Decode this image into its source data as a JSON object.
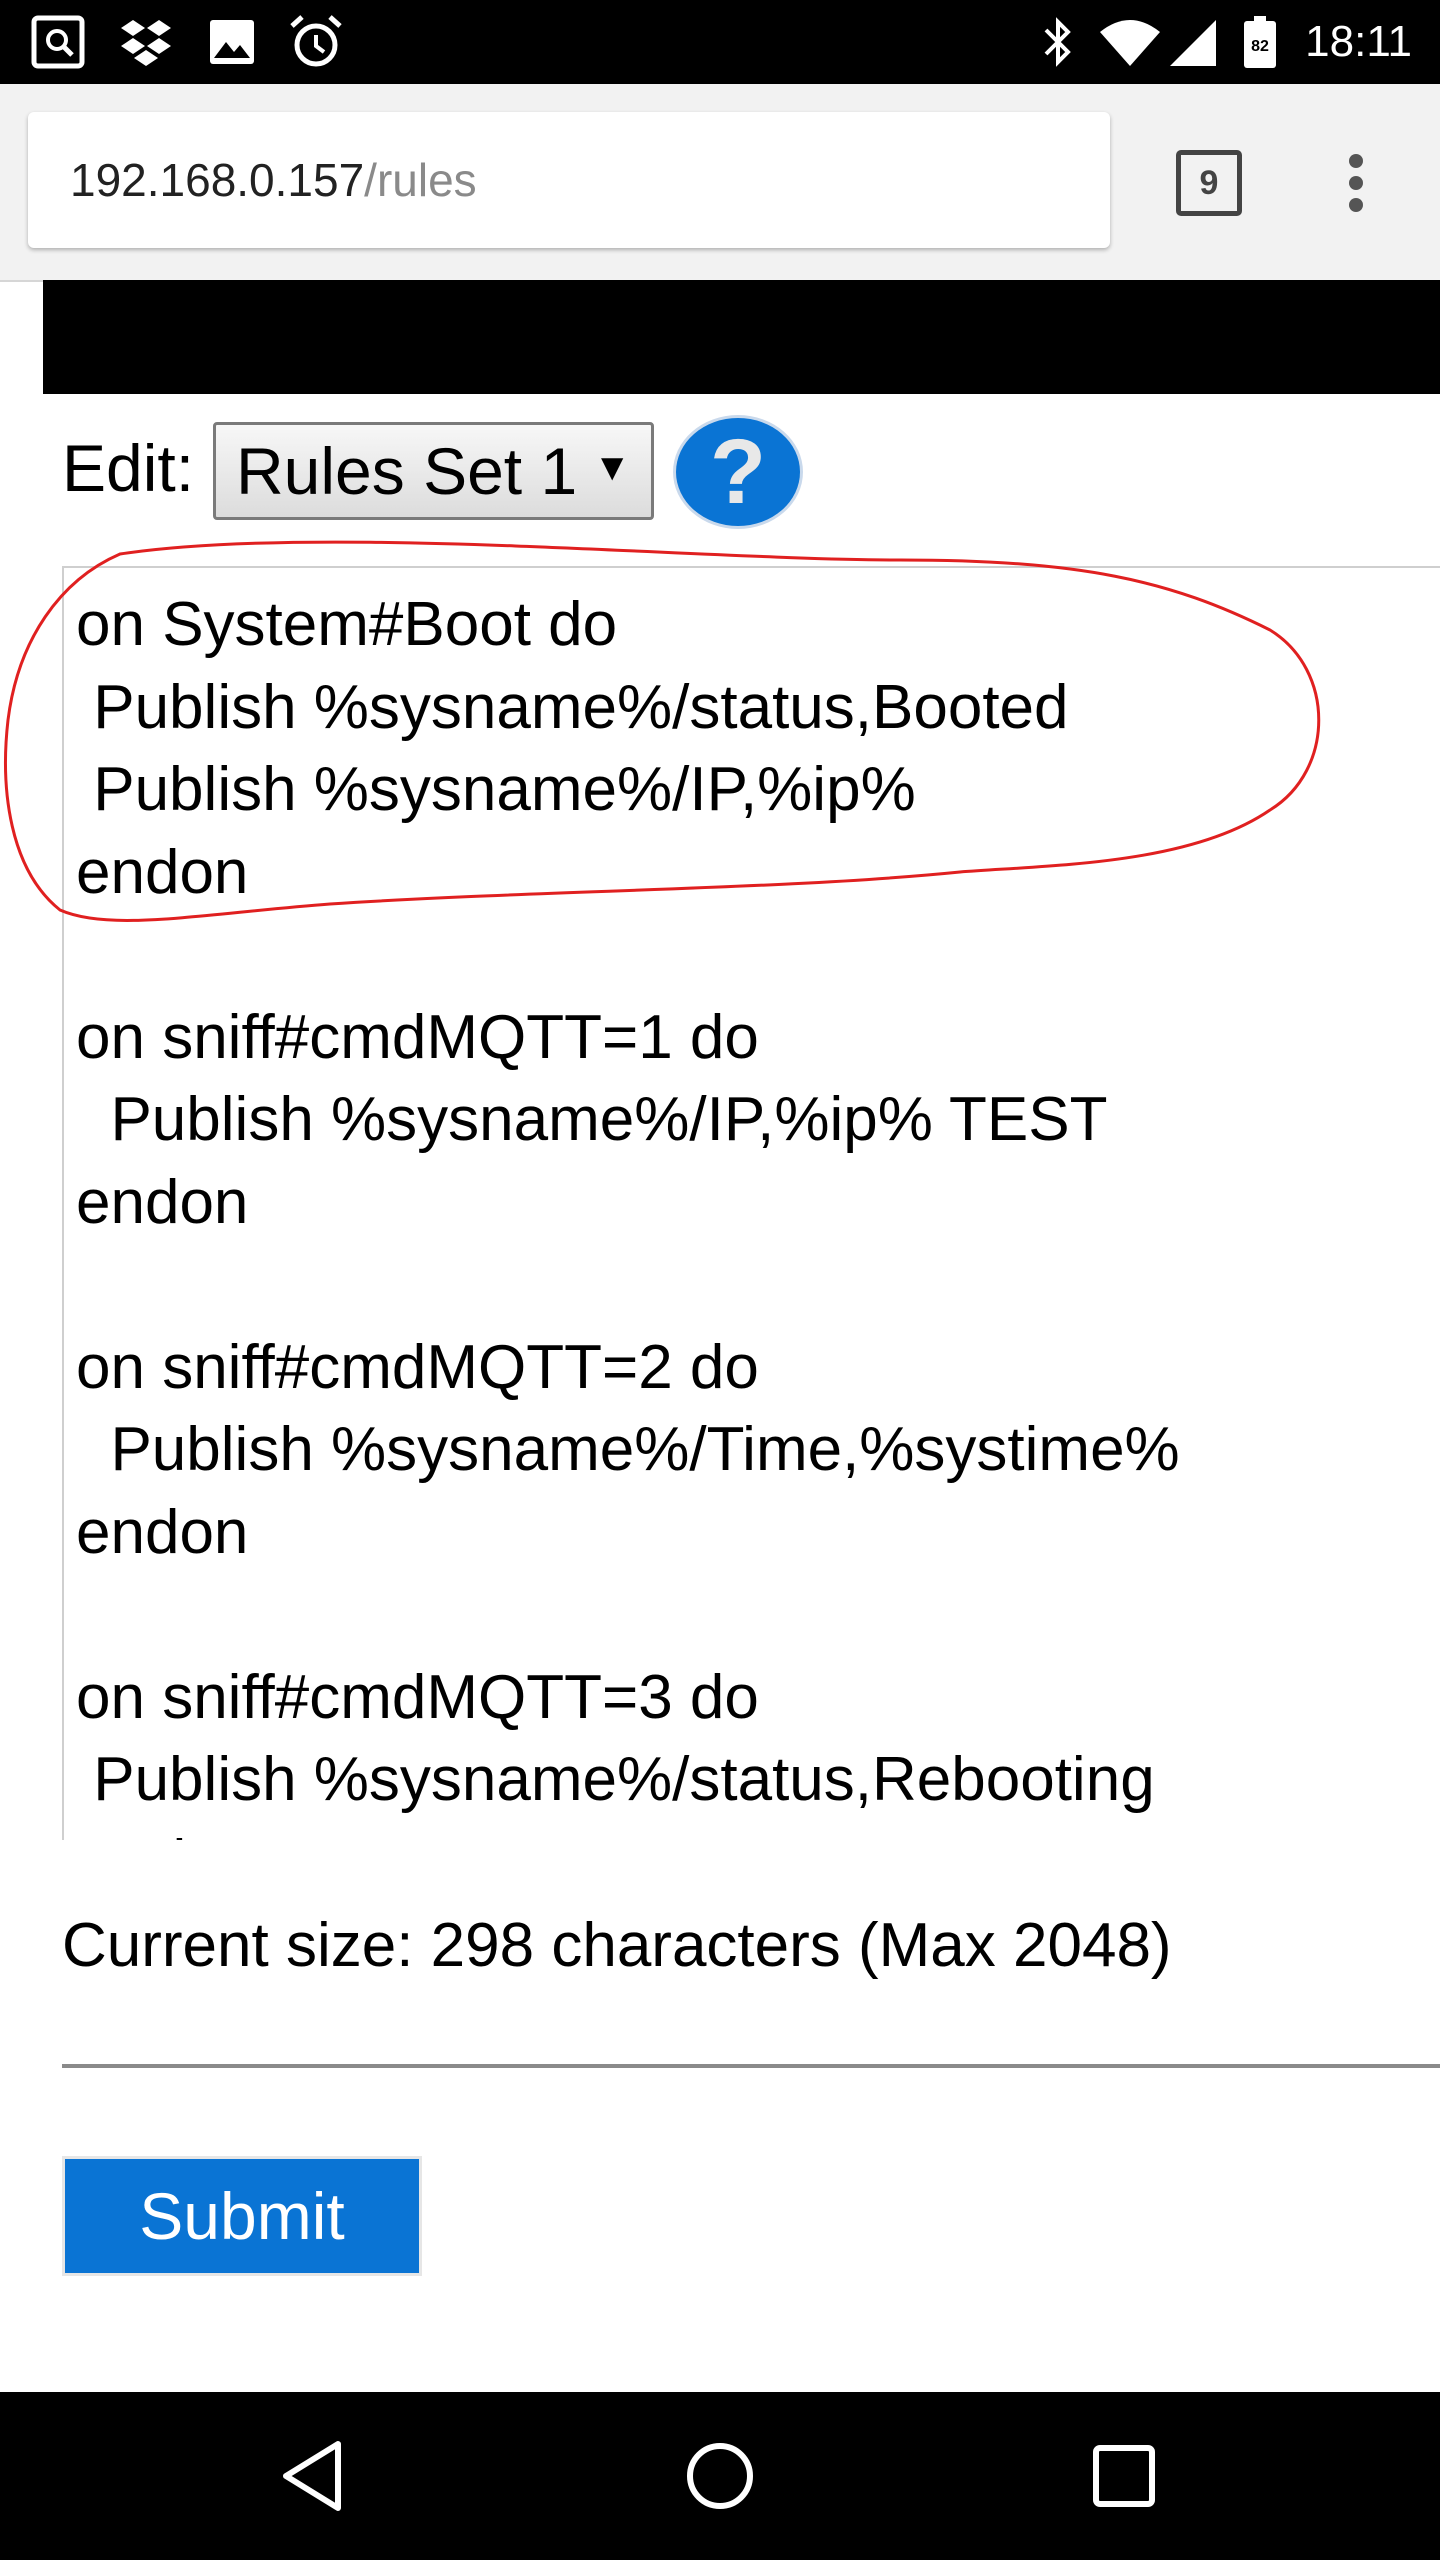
{
  "status_bar": {
    "time": "18:11",
    "battery_level": "82",
    "left_icons": [
      "screenshot-icon",
      "dropbox-icon",
      "image-icon",
      "alarm-icon"
    ],
    "right_icons": [
      "bluetooth-icon",
      "wifi-icon",
      "signal-icon",
      "battery-icon"
    ]
  },
  "browser": {
    "url_host": "192.168.0.157",
    "url_path": "/rules",
    "tab_count": "9",
    "menu_icon": "more-vert-icon"
  },
  "page": {
    "edit_label": "Edit:",
    "rules_select": {
      "selected": "Rules Set 1",
      "arrow": "▼"
    },
    "help_label": "?",
    "rules_text": "on System#Boot do\n Publish %sysname%/status,Booted\n Publish %sysname%/IP,%ip%\nendon\n\non sniff#cmdMQTT=1 do\n  Publish %sysname%/IP,%ip% TEST\nendon\n\non sniff#cmdMQTT=2 do\n  Publish %sysname%/Time,%systime%\nendon\n\non sniff#cmdMQTT=3 do\n Publish %sysname%/status,Rebooting\n Reboot\nendon",
    "size_text": "Current size: 298 characters (Max 2048)",
    "submit_label": "Submit"
  },
  "colors": {
    "accent_blue": "#0a74d4",
    "annotation_red": "#e02020"
  }
}
